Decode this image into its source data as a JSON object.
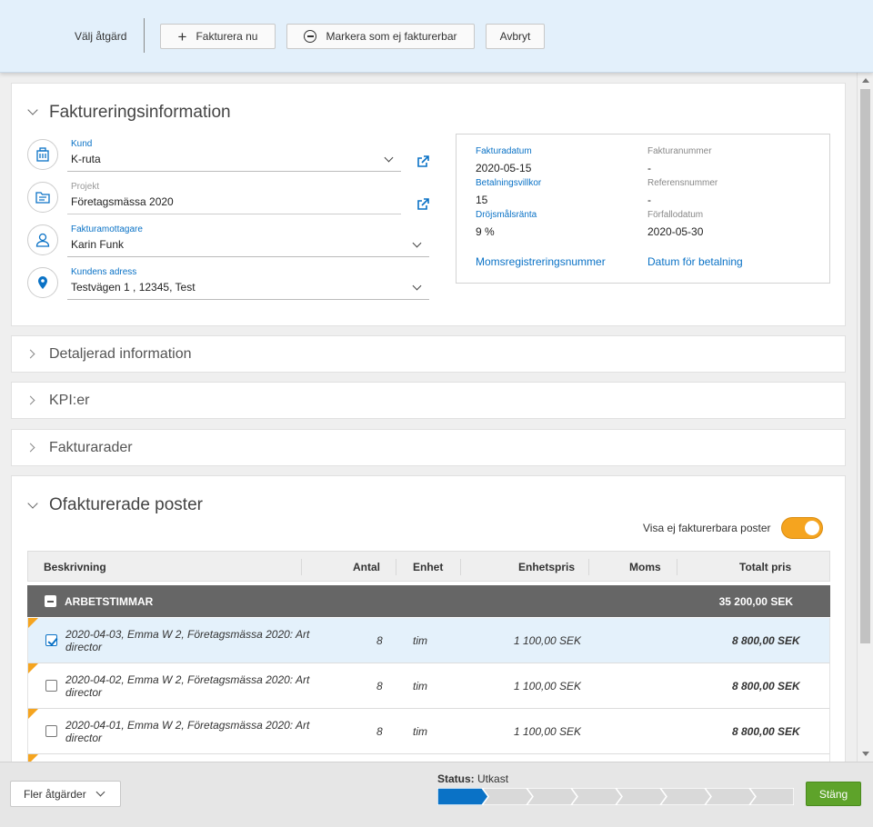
{
  "toolbar": {
    "action_label": "Välj åtgärd",
    "invoice_now_label": "Fakturera nu",
    "mark_non_billable_label": "Markera som ej fakturerbar",
    "cancel_label": "Avbryt"
  },
  "billing_info": {
    "title": "Faktureringsinformation",
    "customer": {
      "label": "Kund",
      "value": "K-ruta"
    },
    "project": {
      "label": "Projekt",
      "value": "Företagsmässa 2020"
    },
    "recipient": {
      "label": "Fakturamottagare",
      "value": "Karin Funk"
    },
    "address": {
      "label": "Kundens adress",
      "value": "Testvägen 1 , 12345, Test"
    },
    "invoice_date": {
      "label": "Fakturadatum",
      "value": "2020-05-15"
    },
    "invoice_number": {
      "label": "Fakturanummer",
      "value": "-"
    },
    "payment_terms": {
      "label": "Betalningsvillkor",
      "value": "15"
    },
    "reference_number": {
      "label": "Referensnummer",
      "value": "-"
    },
    "late_interest": {
      "label": "Dröjsmålsränta",
      "value": "9 %"
    },
    "due_date": {
      "label": "Förfallodatum",
      "value": "2020-05-30"
    },
    "vat_link": "Momsregistreringsnummer",
    "payment_date_link": "Datum för betalning"
  },
  "sections": {
    "details": "Detaljerad information",
    "kpis": "KPI:er",
    "invoice_rows": "Fakturarader"
  },
  "unbilled": {
    "title": "Ofakturerade poster",
    "toggle_label": "Visa ej fakturerbara poster",
    "columns": [
      "Beskrivning",
      "Antal",
      "Enhet",
      "Enhetspris",
      "Moms",
      "Totalt pris"
    ],
    "group": {
      "title": "ARBETSTIMMAR",
      "total": "35 200,00 SEK"
    },
    "rows": [
      {
        "desc": "2020-04-03, Emma W 2, Företagsmässa 2020: Art director",
        "qty": "8",
        "unit": "tim",
        "price": "1 100,00 SEK",
        "total": "8 800,00 SEK",
        "checked": true
      },
      {
        "desc": "2020-04-02, Emma W 2, Företagsmässa 2020: Art director",
        "qty": "8",
        "unit": "tim",
        "price": "1 100,00 SEK",
        "total": "8 800,00 SEK",
        "checked": false
      },
      {
        "desc": "2020-04-01, Emma W 2, Företagsmässa 2020: Art director",
        "qty": "8",
        "unit": "tim",
        "price": "1 100,00 SEK",
        "total": "8 800,00 SEK",
        "checked": false
      }
    ]
  },
  "footer": {
    "more_actions_label": "Fler åtgärder",
    "status_label": "Status:",
    "status_value": "Utkast",
    "close_label": "Stäng",
    "progress_steps": 8,
    "progress_current": 1
  },
  "colors": {
    "accent": "#0a72c6",
    "toggle": "#f5a41f",
    "close": "#5ea32a",
    "group_header": "#666666"
  }
}
